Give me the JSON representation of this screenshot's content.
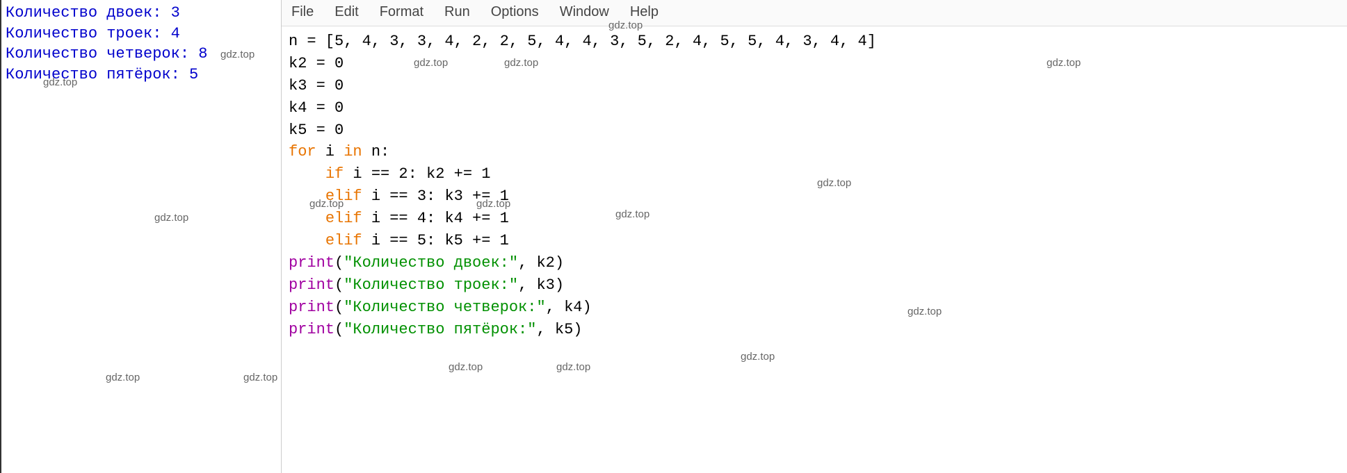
{
  "output": {
    "lines": [
      "Количество двоек: 3",
      "Количество троек: 4",
      "Количество четверок: 8",
      "Количество пятёрок: 5"
    ]
  },
  "menu": {
    "items": [
      "File",
      "Edit",
      "Format",
      "Run",
      "Options",
      "Window",
      "Help"
    ]
  },
  "code": {
    "l1": "n = [5, 4, 3, 3, 4, 2, 2, 5, 4, 4, 3, 5, 2, 4, 5, 5, 4, 3, 4, 4]",
    "l2": "k2 = 0",
    "l3": "k3 = 0",
    "l4": "k4 = 0",
    "l5": "k5 = 0",
    "l6a": "for",
    "l6b": " i ",
    "l6c": "in",
    "l6d": " n:",
    "l7a": "    ",
    "l7b": "if",
    "l7c": " i == 2: k2 += 1",
    "l8a": "    ",
    "l8b": "elif",
    "l8c": " i == 3: k3 += 1",
    "l9a": "    ",
    "l9b": "elif",
    "l9c": " i == 4: k4 += 1",
    "l10a": "    ",
    "l10b": "elif",
    "l10c": " i == 5: k5 += 1",
    "l11a": "print",
    "l11b": "(",
    "l11c": "\"Количество двоек:\"",
    "l11d": ", k2)",
    "l12a": "print",
    "l12b": "(",
    "l12c": "\"Количество троек:\"",
    "l12d": ", k3)",
    "l13a": "print",
    "l13b": "(",
    "l13c": "\"Количество четверок:\"",
    "l13d": ", k4)",
    "l14a": "print",
    "l14b": "(",
    "l14c": "\"Количество пятёрок:\"",
    "l14d": ", k5)"
  },
  "watermark": "gdz.top"
}
